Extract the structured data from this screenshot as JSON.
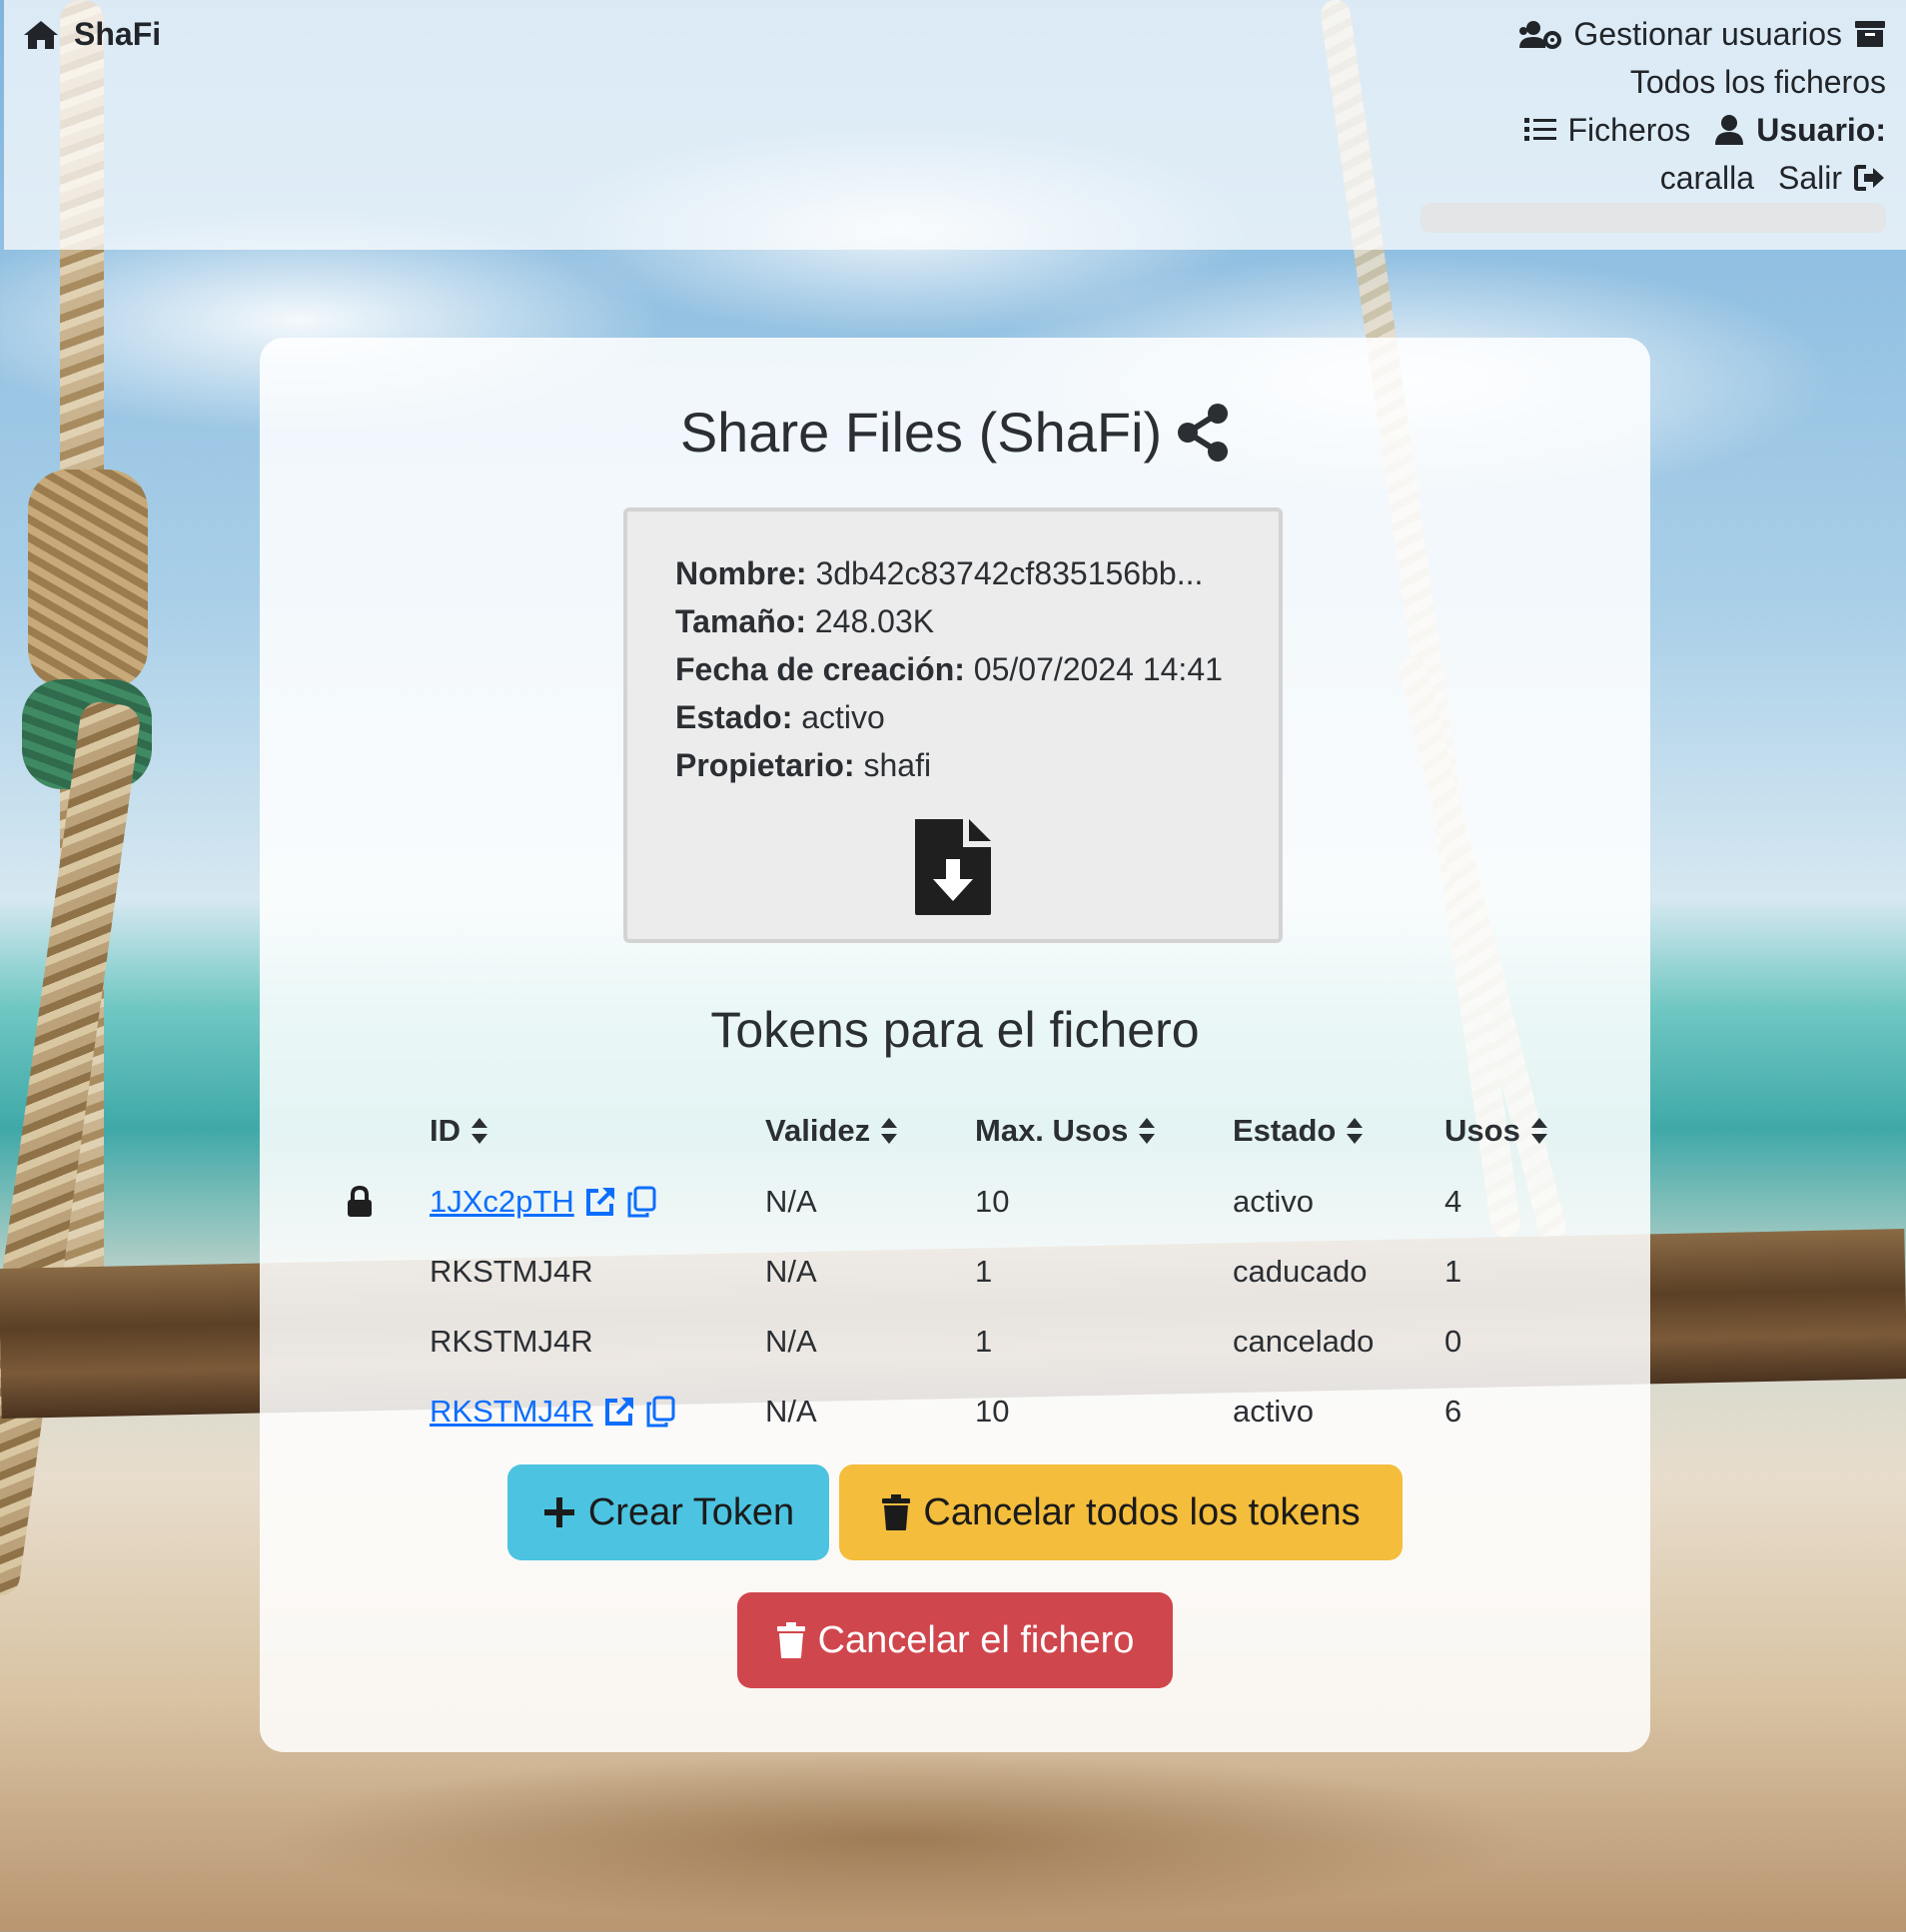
{
  "brand": {
    "name": "ShaFi"
  },
  "nav": {
    "manage_users": "Gestionar usuarios",
    "all_files": "Todos los ficheros",
    "files": "Ficheros",
    "user_label": "Usuario:",
    "username": "caralla",
    "logout": "Salir"
  },
  "main": {
    "title": "Share Files (ShaFi)",
    "file": {
      "name_label": "Nombre:",
      "name": "3db42c83742cf835156bb...",
      "size_label": "Tamaño:",
      "size": "248.03K",
      "created_label": "Fecha de creación:",
      "created": "05/07/2024 14:41",
      "status_label": "Estado:",
      "status": "activo",
      "owner_label": "Propietario:",
      "owner": "shafi"
    },
    "tokens_title": "Tokens para el fichero",
    "table": {
      "headers": [
        "ID",
        "Validez",
        "Max. Usos",
        "Estado",
        "Usos"
      ],
      "rows": [
        {
          "id": "1JXc2pTH",
          "validity": "N/A",
          "max_uses": "10",
          "status": "activo",
          "uses": "4"
        },
        {
          "id": "RKSTMJ4R",
          "validity": "N/A",
          "max_uses": "1",
          "status": "caducado",
          "uses": "1"
        },
        {
          "id": "RKSTMJ4R",
          "validity": "N/A",
          "max_uses": "1",
          "status": "cancelado",
          "uses": "0"
        },
        {
          "id": "RKSTMJ4R",
          "validity": "N/A",
          "max_uses": "10",
          "status": "activo",
          "uses": "6"
        }
      ]
    },
    "buttons": {
      "create_token": "Crear Token",
      "cancel_all_tokens": "Cancelar todos los tokens",
      "cancel_file": "Cancelar el fichero"
    }
  },
  "colors": {
    "info": "#4cc3e1",
    "warning": "#f4bd3c",
    "danger": "#d0464d",
    "link": "#0d6efd"
  }
}
